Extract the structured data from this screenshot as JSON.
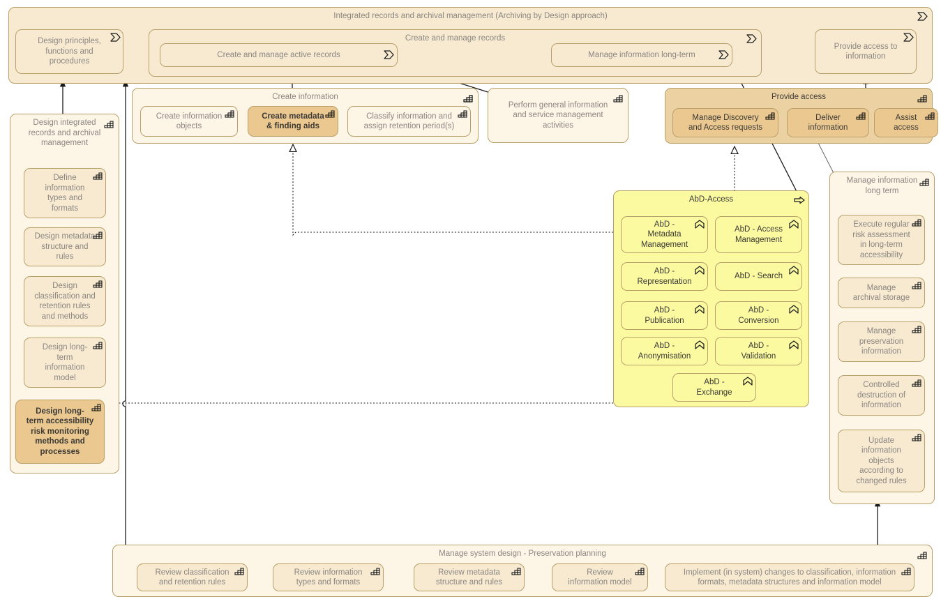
{
  "diagram": {
    "title": "Integrated records and archival management (Archiving by Design approach)",
    "colors": {
      "pale": "#fdf6e7",
      "mid": "#f7ead1",
      "tan": "#ecd1a2",
      "highlight": "#ebc88f",
      "yellow": "#fbfaa0",
      "border": "#b9a06a",
      "text": "#8b8681",
      "text_dark": "#3c3a37",
      "line": "#1a1a1a"
    }
  },
  "top_group": {
    "label": "Integrated records and archival management (Archiving by Design approach)",
    "icon": "process-chevron-icon",
    "design_principles": {
      "label": "Design principles,\nfunctions and\nprocedures",
      "icon": "process-chevron-icon"
    },
    "create_manage_records": {
      "label": "Create and manage records",
      "icon": "process-chevron-icon",
      "create_active": {
        "label": "Create and manage active records",
        "icon": "process-chevron-icon"
      },
      "manage_long_term": {
        "label": "Manage information long-term",
        "icon": "process-chevron-icon"
      }
    },
    "provide_access_to_information": {
      "label": "Provide access to\ninformation",
      "icon": "process-chevron-icon"
    }
  },
  "create_information": {
    "label": "Create information",
    "icon": "function-steps-icon",
    "items": [
      {
        "label": "Create information\nobjects",
        "icon": "function-steps-icon",
        "highlight": false
      },
      {
        "label": "Create metadata\n& finding aids",
        "icon": "function-steps-icon",
        "highlight": true
      },
      {
        "label": "Classify information and\nassign retention period(s)",
        "icon": "function-steps-icon",
        "highlight": false
      }
    ]
  },
  "perform_general": {
    "label": "Perform general information\nand service management\nactivities",
    "icon": "function-steps-icon"
  },
  "provide_access": {
    "label": "Provide access",
    "icon": "function-steps-icon",
    "items": [
      {
        "label": "Manage Discovery\nand Access requests",
        "icon": "function-steps-icon"
      },
      {
        "label": "Deliver\ninformation",
        "icon": "function-steps-icon"
      },
      {
        "label": "Assist\naccess",
        "icon": "function-steps-icon"
      }
    ]
  },
  "design_group": {
    "label": "Design integrated\nrecords and archival\nmanagement",
    "icon": "function-steps-icon",
    "items": [
      {
        "label": "Define\ninformation\ntypes and\nformats",
        "icon": "function-steps-icon",
        "highlight": false
      },
      {
        "label": "Design metadata\nstructure and\nrules",
        "icon": "function-steps-icon",
        "highlight": false
      },
      {
        "label": "Design\nclassification and\nretention rules\nand methods",
        "icon": "function-steps-icon",
        "highlight": false
      },
      {
        "label": "Design long-\nterm\ninformation\nmodel",
        "icon": "function-steps-icon",
        "highlight": false
      },
      {
        "label": "Design long-\nterm accessibility\nrisk monitoring\nmethods and\nprocesses",
        "icon": "function-steps-icon",
        "highlight": true
      }
    ]
  },
  "abd_access": {
    "label": "AbD-Access",
    "icon": "arrow-right-icon",
    "items": [
      {
        "label": "AbD -\nMetadata\nManagement",
        "icon": "component-chevron-icon"
      },
      {
        "label": "AbD - Access\nManagement",
        "icon": "component-chevron-icon"
      },
      {
        "label": "AbD -\nRepresentation",
        "icon": "component-chevron-icon"
      },
      {
        "label": "AbD - Search",
        "icon": "component-chevron-icon"
      },
      {
        "label": "AbD -\nPublication",
        "icon": "component-chevron-icon"
      },
      {
        "label": "AbD -\nConversion",
        "icon": "component-chevron-icon"
      },
      {
        "label": "AbD -\nAnonymisation",
        "icon": "component-chevron-icon"
      },
      {
        "label": "AbD -\nValidation",
        "icon": "component-chevron-icon"
      },
      {
        "label": "AbD -\nExchange",
        "icon": "component-chevron-icon"
      }
    ]
  },
  "manage_long_term_group": {
    "label": "Manage information\nlong term",
    "icon": "function-steps-icon",
    "items": [
      {
        "label": "Execute regular\nrisk assessment\nin long-term\naccessibility",
        "icon": "function-steps-icon"
      },
      {
        "label": "Manage\narchival storage",
        "icon": "function-steps-icon"
      },
      {
        "label": "Manage\npreservation\ninformation",
        "icon": "function-steps-icon"
      },
      {
        "label": "Controlled\ndestruction of\ninformation",
        "icon": "function-steps-icon"
      },
      {
        "label": "Update\ninformation\nobjects\naccording to\nchanged rules",
        "icon": "function-steps-icon"
      }
    ]
  },
  "manage_system_design": {
    "label": "Manage system design - Preservation planning",
    "icon": "function-steps-icon",
    "items": [
      {
        "label": "Review classification\nand retention rules",
        "icon": "function-steps-icon"
      },
      {
        "label": "Review information\ntypes and formats",
        "icon": "function-steps-icon"
      },
      {
        "label": "Review metadata\nstructure and rules",
        "icon": "function-steps-icon"
      },
      {
        "label": "Review\ninformation model",
        "icon": "function-steps-icon"
      },
      {
        "label": "Implement (in system) changes to classification, information\nformats, metadata structures and information model",
        "icon": "function-steps-icon"
      }
    ]
  }
}
